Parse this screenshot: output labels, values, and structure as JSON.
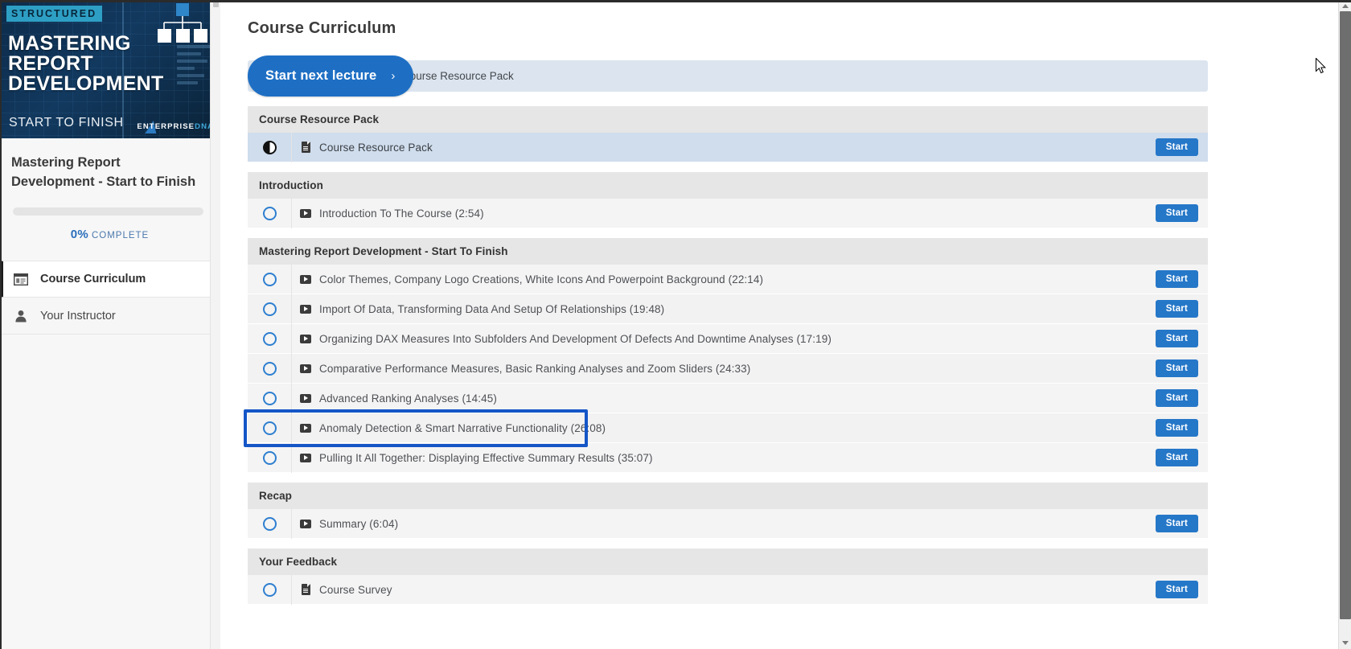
{
  "sidebar": {
    "banner": {
      "tag": "STRUCTURED",
      "title_line1": "MASTERING",
      "title_line2": "REPORT",
      "title_line3": "DEVELOPMENT",
      "subtitle": "START TO FINISH",
      "brand_primary": "ENTERPRISE",
      "brand_secondary": "DNA"
    },
    "course_title": "Mastering Report Development - Start to Finish",
    "progress_percent": "0%",
    "progress_word": "COMPLETE",
    "progress_value": 0,
    "nav": [
      {
        "label": "Course Curriculum",
        "icon": "curriculum-icon",
        "active": true
      },
      {
        "label": "Your Instructor",
        "icon": "person-icon",
        "active": false
      }
    ]
  },
  "main": {
    "page_title": "Course Curriculum",
    "next_button_label": "Start next lecture",
    "next_button_chevron": "›",
    "next_lecture_name": "Course Resource Pack",
    "start_label": "Start",
    "sections": [
      {
        "title": "Course Resource Pack",
        "rows": [
          {
            "label": "Course Resource Pack",
            "icon": "document-icon",
            "status": "half-circle-icon",
            "current": true,
            "start": "Start"
          }
        ]
      },
      {
        "title": "Introduction",
        "rows": [
          {
            "label": "Introduction To The Course (2:54)",
            "icon": "video-icon",
            "status": "circle-icon",
            "current": false,
            "start": "Start"
          }
        ]
      },
      {
        "title": "Mastering Report Development - Start To Finish",
        "rows": [
          {
            "label": "Color Themes, Company Logo Creations, White Icons And Powerpoint Background (22:14)",
            "icon": "video-icon",
            "status": "circle-icon",
            "current": false,
            "start": "Start"
          },
          {
            "label": "Import Of Data, Transforming Data And Setup Of Relationships (19:48)",
            "icon": "video-icon",
            "status": "circle-icon",
            "current": false,
            "start": "Start"
          },
          {
            "label": "Organizing DAX Measures Into Subfolders And Development Of Defects And Downtime Analyses (17:19)",
            "icon": "video-icon",
            "status": "circle-icon",
            "current": false,
            "start": "Start"
          },
          {
            "label": "Comparative Performance Measures, Basic Ranking Analyses and Zoom Sliders (24:33)",
            "icon": "video-icon",
            "status": "circle-icon",
            "current": false,
            "start": "Start"
          },
          {
            "label": "Advanced Ranking Analyses (14:45)",
            "icon": "video-icon",
            "status": "circle-icon",
            "current": false,
            "start": "Start"
          },
          {
            "label": "Anomaly Detection & Smart Narrative Functionality (26:08)",
            "icon": "video-icon",
            "status": "circle-icon",
            "current": false,
            "start": "Start",
            "annotated": true
          },
          {
            "label": "Pulling It All Together: Displaying Effective Summary Results (35:07)",
            "icon": "video-icon",
            "status": "circle-icon",
            "current": false,
            "start": "Start"
          }
        ]
      },
      {
        "title": "Recap",
        "rows": [
          {
            "label": "Summary (6:04)",
            "icon": "video-icon",
            "status": "circle-icon",
            "current": false,
            "start": "Start"
          }
        ]
      },
      {
        "title": "Your Feedback",
        "rows": [
          {
            "label": "Course Survey",
            "icon": "document-icon",
            "status": "circle-icon",
            "current": false,
            "start": "Start"
          }
        ]
      }
    ]
  },
  "colors": {
    "accent_blue": "#1e6fc4",
    "start_button": "#2577c8",
    "annotation": "#1556c7",
    "current_row": "#cfdded",
    "section_header": "#e6e6e6",
    "banner_dark": "#0d2b4a",
    "tag_cyan": "#2e9fc4"
  }
}
